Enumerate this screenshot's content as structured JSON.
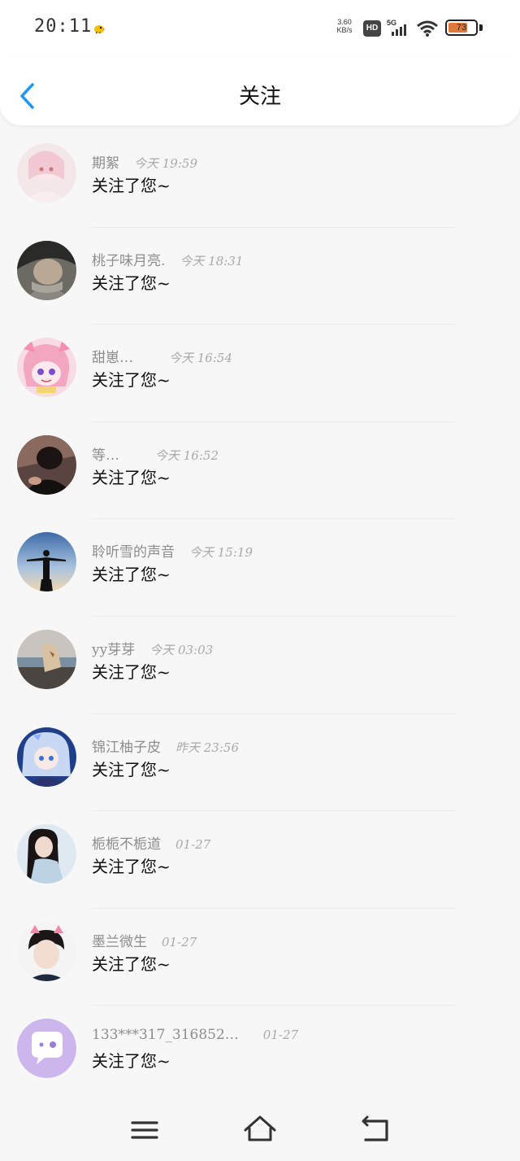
{
  "status": {
    "time": "20:11",
    "net_speed_value": "3.60",
    "net_speed_unit": "KB/s",
    "hd": "HD",
    "network": "5G",
    "battery": "73",
    "battery_level": 0.73,
    "battery_color": "#e07a3a"
  },
  "header": {
    "title": "关注",
    "back_icon": "chevron-left-icon",
    "accent": "#2196f3"
  },
  "follows": [
    {
      "name": "期絮",
      "time": "今天 19:59",
      "message": "关注了您~"
    },
    {
      "name": "桃子味月亮.",
      "time": "今天 18:31",
      "message": "关注了您~"
    },
    {
      "name": "甜崽…",
      "time": "今天 16:54",
      "message": "关注了您~"
    },
    {
      "name": "等…",
      "time": "今天 16:52",
      "message": "关注了您~"
    },
    {
      "name": "聆听雪的声音",
      "time": "今天 15:19",
      "message": "关注了您~"
    },
    {
      "name": "yy芽芽",
      "time": "今天 03:03",
      "message": "关注了您~"
    },
    {
      "name": "锦江柚子皮",
      "time": "昨天 23:56",
      "message": "关注了您~"
    },
    {
      "name": "栀栀不栀道",
      "time": "01-27",
      "message": "关注了您~"
    },
    {
      "name": "墨兰微生",
      "time": "01-27",
      "message": "关注了您~"
    },
    {
      "name": "133***317_316852…",
      "time": "01-27",
      "message": "关注了您~"
    }
  ],
  "navbar": {
    "icons": [
      "menu-icon",
      "home-icon",
      "back-icon"
    ]
  }
}
